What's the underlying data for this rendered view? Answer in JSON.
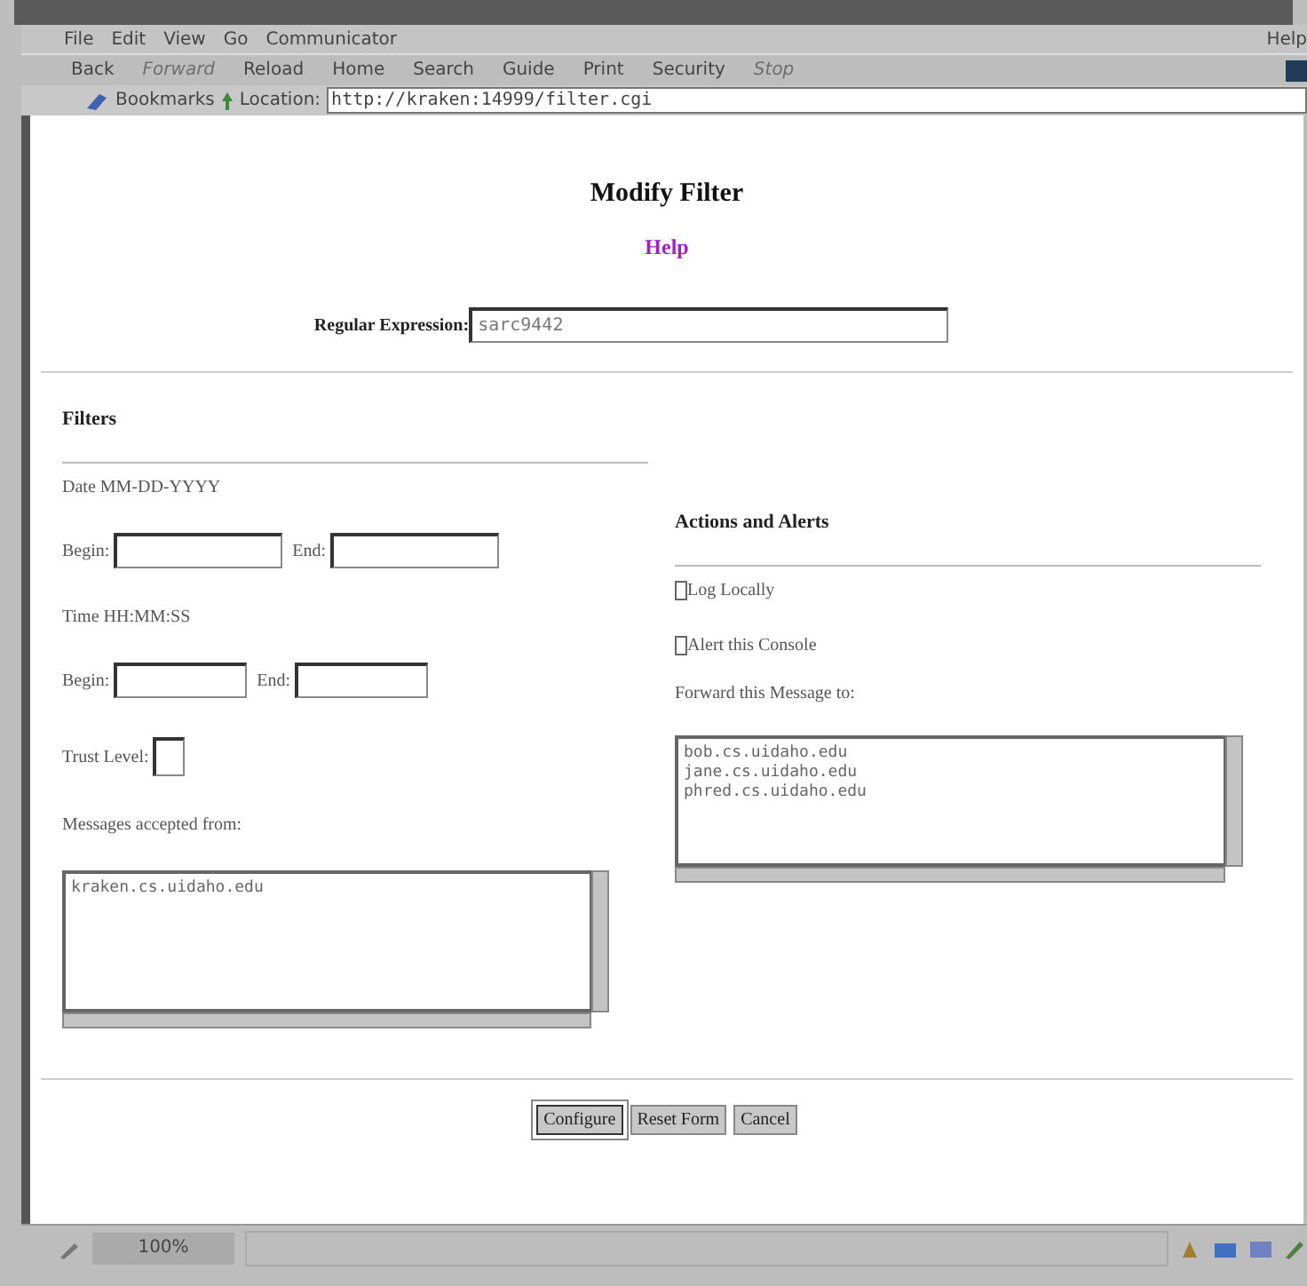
{
  "menu": [
    {
      "label": "File"
    },
    {
      "label": "Edit"
    },
    {
      "label": "View"
    },
    {
      "label": "Go"
    },
    {
      "label": "Communicator"
    }
  ],
  "help_menu": "Help",
  "toolbar": [
    {
      "label": "Back",
      "disabled": false
    },
    {
      "label": "Forward",
      "disabled": true
    },
    {
      "label": "Reload",
      "disabled": false
    },
    {
      "label": "Home",
      "disabled": false
    },
    {
      "label": "Search",
      "disabled": false
    },
    {
      "label": "Guide",
      "disabled": false
    },
    {
      "label": "Print",
      "disabled": false
    },
    {
      "label": "Security",
      "disabled": false
    },
    {
      "label": "Stop",
      "disabled": true
    }
  ],
  "location_bar": {
    "bookmarks": "Bookmarks",
    "location_label": "Location:",
    "url": "http://kraken:14999/filter.cgi"
  },
  "page": {
    "title": "Modify Filter",
    "help_link": "Help",
    "regex_label": "Regular Expression:",
    "regex_value": "sarc9442"
  },
  "filters": {
    "heading": "Filters",
    "date_label": "Date MM-DD-YYYY",
    "date_begin_label": "Begin:",
    "date_end_label": "End:",
    "time_label": "Time HH:MM:SS",
    "time_begin_label": "Begin:",
    "time_end_label": "End:",
    "trust_label": "Trust Level:",
    "accepted_label": "Messages accepted from:",
    "accepted_lines": [
      "kraken.cs.uidaho.edu"
    ]
  },
  "actions": {
    "heading": "Actions and Alerts",
    "options": [
      {
        "label": "Log Locally",
        "checked": false
      },
      {
        "label": "Alert this Console",
        "checked": false
      }
    ],
    "forward_label": "Forward this Message to:",
    "forward_lines": [
      "bob.cs.uidaho.edu",
      "jane.cs.uidaho.edu",
      "phred.cs.uidaho.edu"
    ]
  },
  "buttons": [
    {
      "label": "Configure",
      "selected": true
    },
    {
      "label": "Reset Form",
      "selected": false
    },
    {
      "label": "Cancel",
      "selected": false
    }
  ],
  "status_bar": {
    "progress_text": "100%"
  }
}
